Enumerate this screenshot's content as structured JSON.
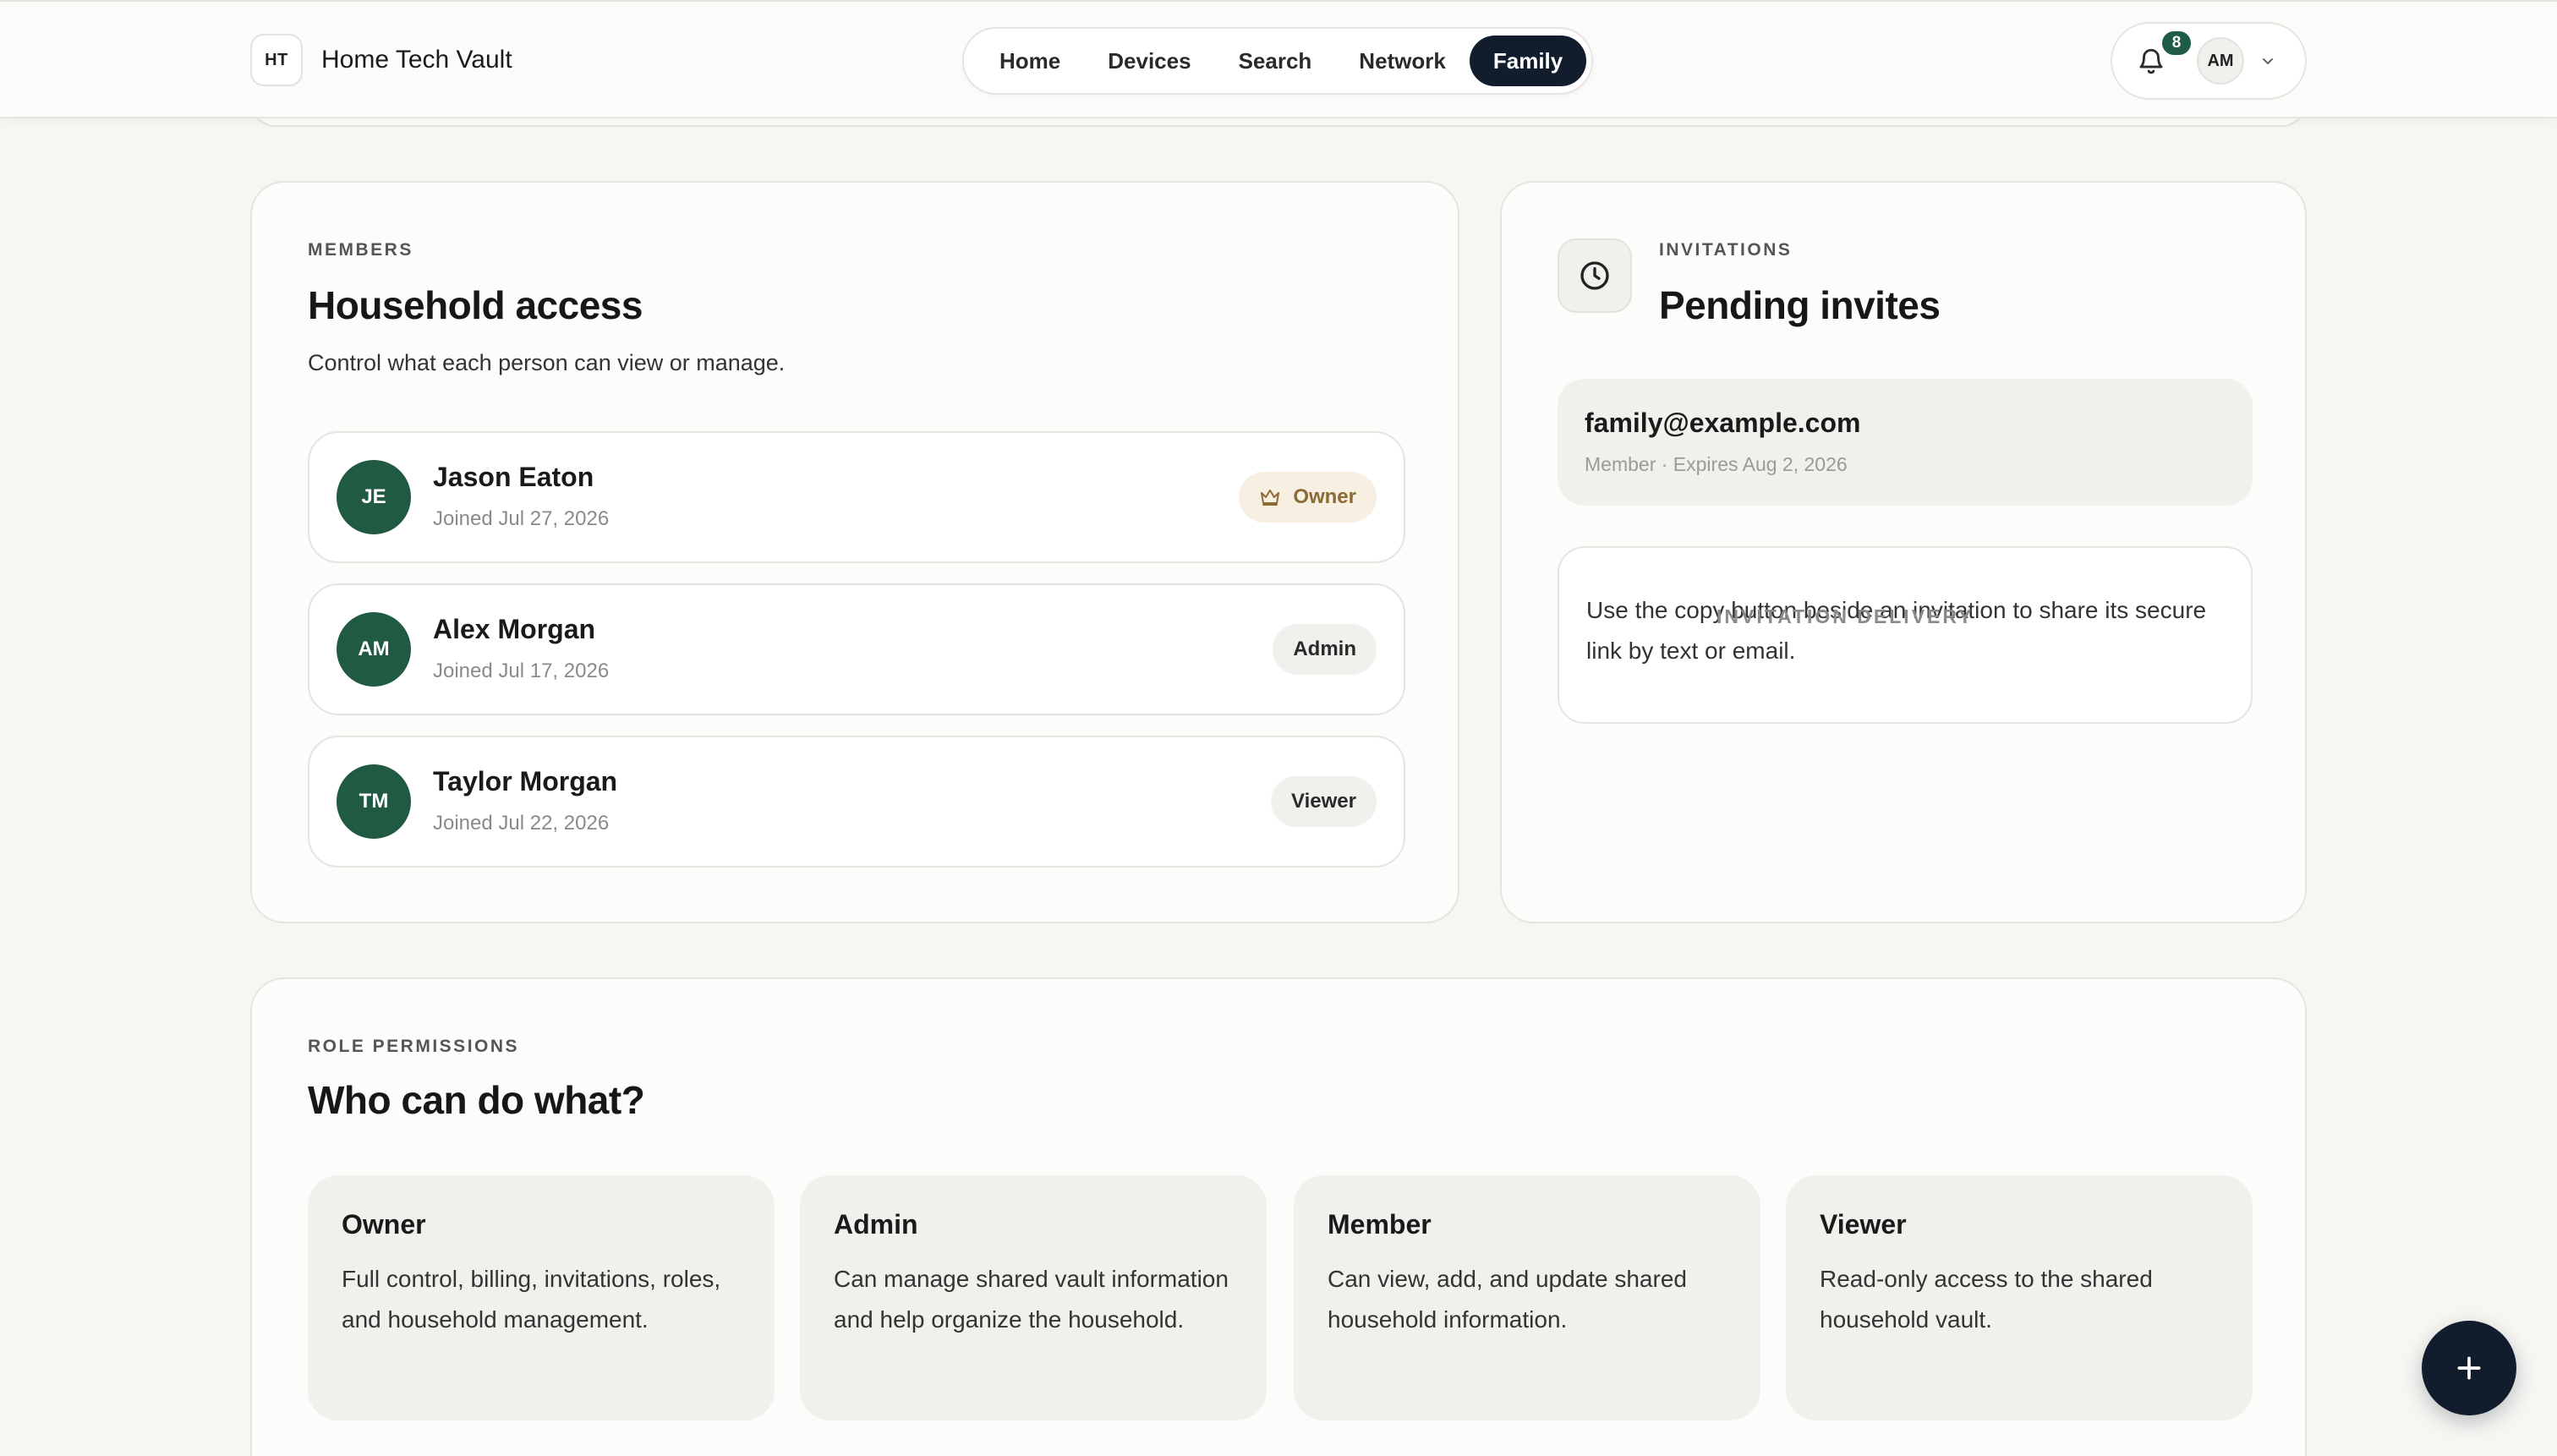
{
  "header": {
    "brand_mark": "HT",
    "brand_name": "Home Tech Vault",
    "nav": [
      {
        "label": "Home",
        "active": false
      },
      {
        "label": "Devices",
        "active": false
      },
      {
        "label": "Search",
        "active": false
      },
      {
        "label": "Network",
        "active": false
      },
      {
        "label": "Family",
        "active": true
      }
    ],
    "notifications_count": "8",
    "user_initials": "AM",
    "icons": {
      "notifications": "bell-icon",
      "menu": "chevron-down-icon"
    }
  },
  "members": {
    "eyebrow": "MEMBERS",
    "title": "Household access",
    "subtitle": "Control what each person can view or manage.",
    "list": [
      {
        "initials": "JE",
        "name": "Jason Eaton",
        "joined": "Joined Jul 27, 2026",
        "role": "Owner",
        "role_icon": "crown-icon"
      },
      {
        "initials": "AM",
        "name": "Alex Morgan",
        "joined": "Joined Jul 17, 2026",
        "role": "Admin"
      },
      {
        "initials": "TM",
        "name": "Taylor Morgan",
        "joined": "Joined Jul 22, 2026",
        "role": "Viewer"
      }
    ]
  },
  "invitations": {
    "icon": "clock-icon",
    "eyebrow": "INVITATIONS",
    "title": "Pending invites",
    "items": [
      {
        "email": "family@example.com",
        "meta": "Member · Expires Aug 2, 2026"
      }
    ],
    "delivery": {
      "eyebrow": "INVITATION DELIVERY",
      "text": "Use the copy button beside an invitation to share its secure link by text or email."
    }
  },
  "permissions": {
    "eyebrow": "ROLE PERMISSIONS",
    "title": "Who can do what?",
    "roles": [
      {
        "title": "Owner",
        "desc": "Full control, billing, invitations, roles, and household management."
      },
      {
        "title": "Admin",
        "desc": "Can manage shared vault information and help organize the household."
      },
      {
        "title": "Member",
        "desc": "Can view, add, and update shared household information."
      },
      {
        "title": "Viewer",
        "desc": "Read-only access to the shared household vault."
      }
    ]
  },
  "fab": {
    "icon": "plus-icon"
  },
  "colors": {
    "accent_dark": "#111d2c",
    "avatar_green": "#215a43",
    "owner_badge": "#f7efe1"
  }
}
